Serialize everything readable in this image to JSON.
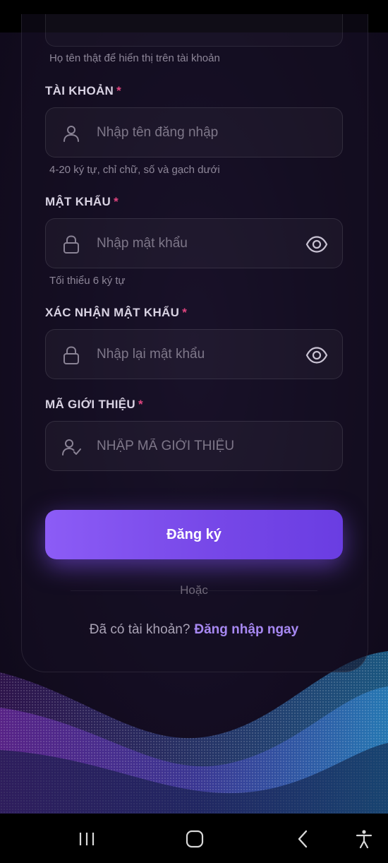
{
  "form": {
    "fullname_hint": "Họ tên thật để hiển thị trên tài khoản",
    "username": {
      "label": "TÀI KHOẢN",
      "required_mark": "*",
      "placeholder": "Nhập tên đăng nhập",
      "hint": "4-20 ký tự, chỉ chữ, số và gạch dưới",
      "icon": "user-icon"
    },
    "password": {
      "label": "MẬT KHẨU",
      "required_mark": "*",
      "placeholder": "Nhập mật khẩu",
      "hint": "Tối thiểu 6 ký tự",
      "icon": "lock-icon",
      "toggle_icon": "eye-icon"
    },
    "confirm_password": {
      "label": "XÁC NHẬN MẬT KHẨU",
      "required_mark": "*",
      "placeholder": "Nhập lại mật khẩu",
      "icon": "lock-icon",
      "toggle_icon": "eye-icon"
    },
    "referral": {
      "label": "MÃ GIỚI THIỆU",
      "required_mark": "*",
      "placeholder": "NHẬP MÃ GIỚI THIỆU",
      "icon": "user-check-icon"
    },
    "submit_label": "Đăng ký",
    "divider_text": "Hoặc",
    "login_prompt": "Đã có tài khoản?",
    "login_link": "Đăng nhập ngay"
  },
  "theme": {
    "accent": "#8c5cf6",
    "required": "#e0457f",
    "link": "#a788f2"
  },
  "nav_bar": {
    "icons": [
      "recent-apps-icon",
      "home-icon",
      "back-icon",
      "accessibility-icon"
    ]
  }
}
